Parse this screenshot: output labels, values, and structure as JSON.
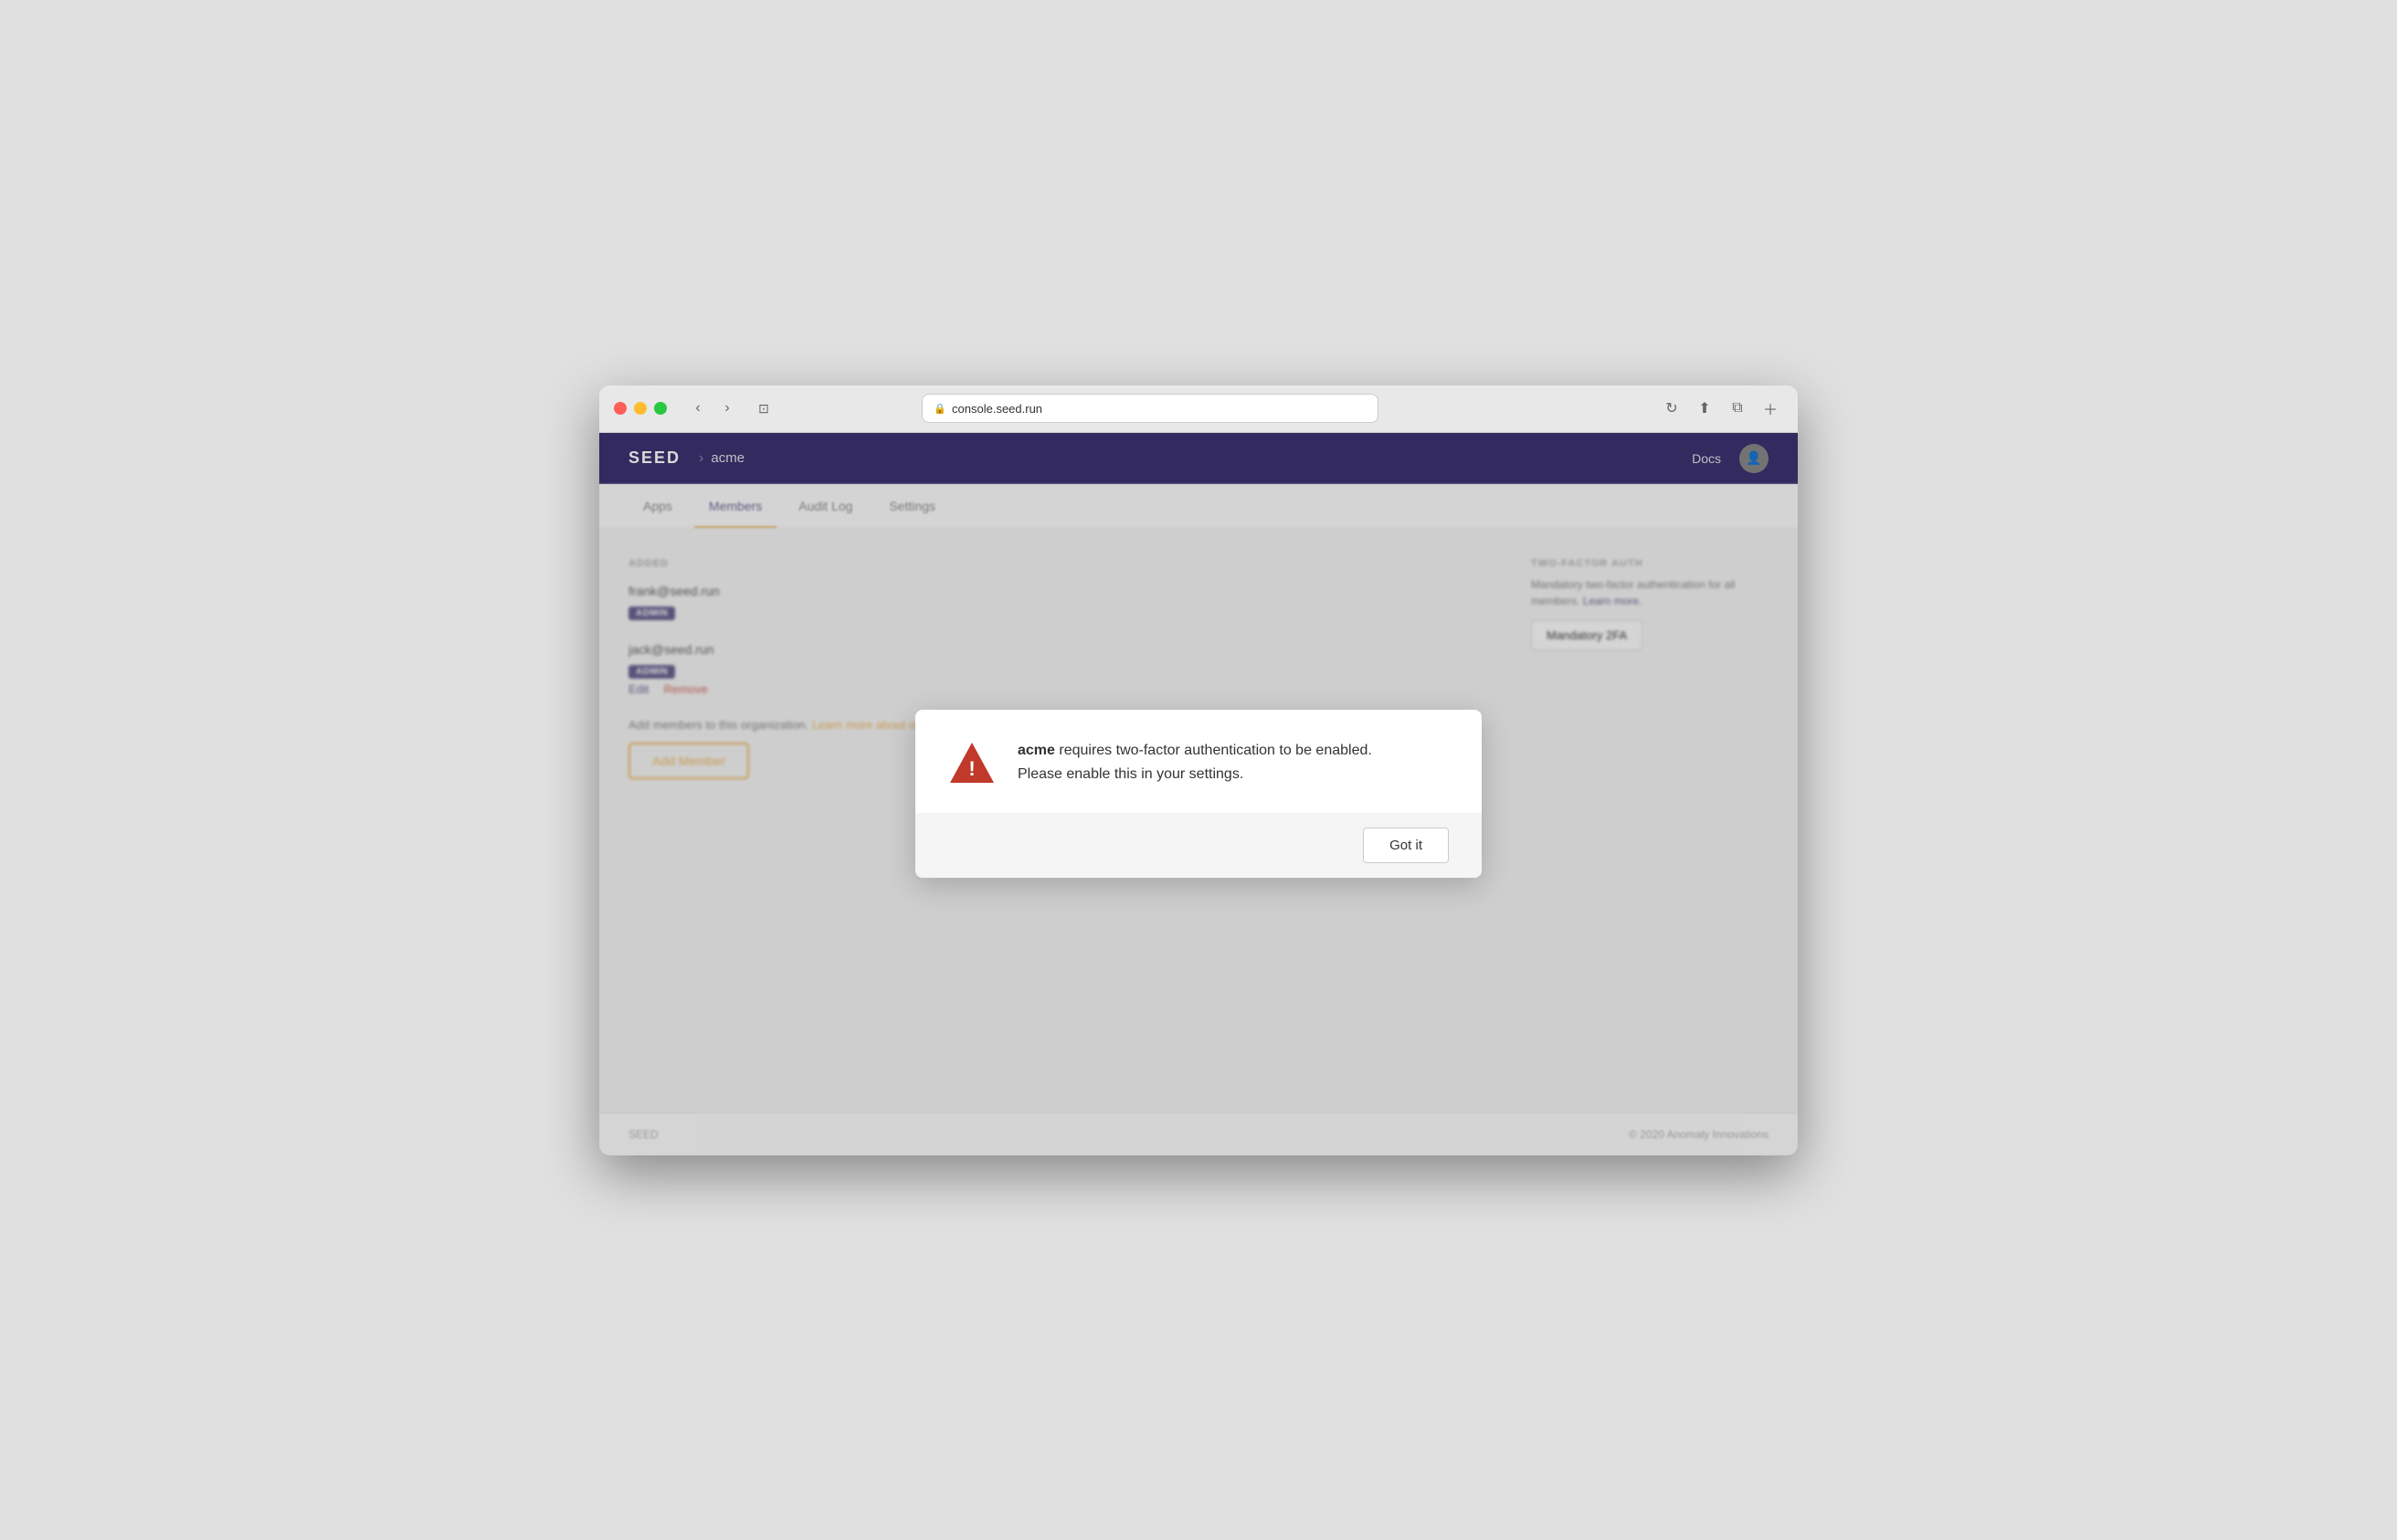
{
  "browser": {
    "url": "console.seed.run",
    "reload_label": "↻"
  },
  "navbar": {
    "logo": "SEED",
    "separator": "›",
    "org_name": "acme",
    "docs_link": "Docs"
  },
  "tabs": [
    {
      "label": "Apps",
      "active": false
    },
    {
      "label": "Members",
      "active": true
    },
    {
      "label": "Audit Log",
      "active": false
    },
    {
      "label": "Settings",
      "active": false
    }
  ],
  "members_section": {
    "section_label": "ADDED",
    "members": [
      {
        "email": "frank@seed.run",
        "role": "ADMIN",
        "show_actions": false
      },
      {
        "email": "jack@seed.run",
        "role": "ADMIN",
        "show_actions": true,
        "edit_label": "Edit",
        "remove_label": "Remove"
      }
    ],
    "add_text": "Add members to this organization.",
    "add_link_text": "Learn more about organization members.",
    "add_button_label": "Add Member"
  },
  "tfa_section": {
    "title": "TWO-FACTOR AUTH",
    "description": "Mandatory two-factor authentication for all members. Learn more.",
    "learn_more_label": "Learn more.",
    "button_label": "Mandatory 2FA"
  },
  "footer": {
    "brand": "SEED",
    "copyright": "© 2020 Anomaly Innovations"
  },
  "modal": {
    "org_name": "acme",
    "message_part1": " requires two-factor authentication to be enabled.",
    "message_part2": "Please enable this in your settings.",
    "got_it_label": "Got it",
    "warning_icon_label": "warning-triangle-icon"
  }
}
